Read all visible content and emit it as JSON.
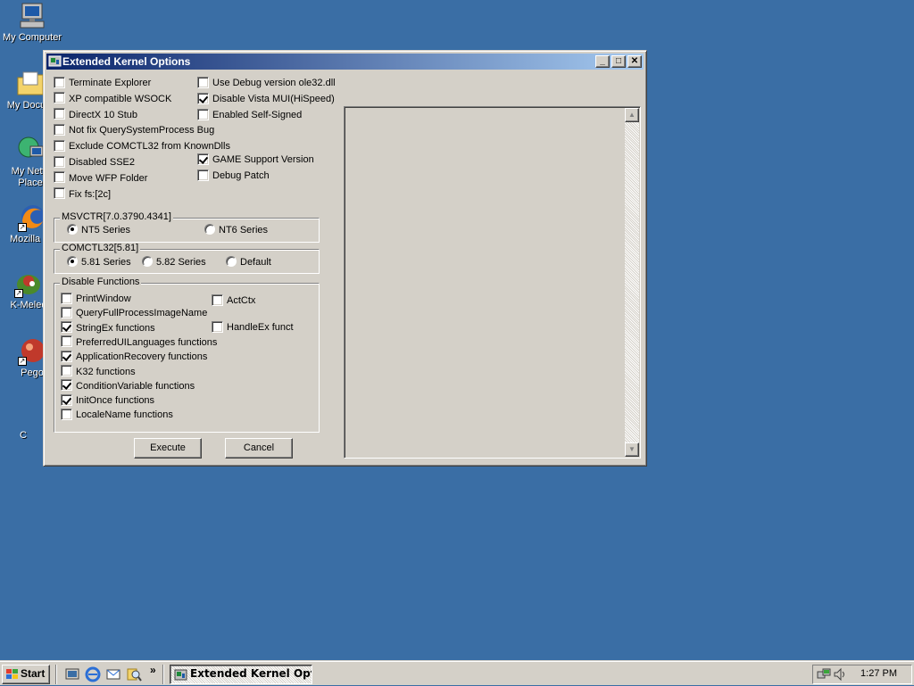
{
  "desktop": {
    "icons": [
      {
        "label": "My Computer",
        "icon": "my-computer-icon"
      },
      {
        "label": "My Docum",
        "icon": "folder-icon"
      },
      {
        "label": "My Netw",
        "label2": "Place",
        "icon": "network-icon"
      },
      {
        "label": "Mozilla Fir",
        "icon": "firefox-icon"
      },
      {
        "label": "K-Meleo",
        "icon": "kmeleon-icon"
      },
      {
        "label": "Pego",
        "icon": "pego-icon"
      },
      {
        "label": "C",
        "icon": "unknown-icon"
      }
    ]
  },
  "window": {
    "title": "Extended Kernel Options",
    "controls": {
      "minimize": "_",
      "maximize": "□",
      "close": "✕"
    },
    "options_left": [
      {
        "label": "Terminate Explorer",
        "checked": false
      },
      {
        "label": "XP compatible WSOCK",
        "checked": false
      },
      {
        "label": "DirectX 10 Stub",
        "checked": false
      },
      {
        "label": "Not fix QuerySystemProcess Bug",
        "checked": false
      },
      {
        "label": "Exclude COMCTL32 from KnownDlls",
        "checked": false
      },
      {
        "label": "Disabled SSE2",
        "checked": false
      },
      {
        "label": "Move WFP Folder",
        "checked": false
      },
      {
        "label": "Fix fs:[2c]",
        "checked": false
      }
    ],
    "options_right": [
      {
        "label": "Use Debug version ole32.dll",
        "checked": false
      },
      {
        "label": "Disable Vista MUI(HiSpeed)",
        "checked": true
      },
      {
        "label": "Enabled Self-Signed",
        "checked": false
      },
      {
        "label": "GAME Support Version",
        "checked": true
      },
      {
        "label": "Debug Patch",
        "checked": false
      }
    ],
    "msvctr": {
      "title": "MSVCTR[7.0.3790.4341]",
      "options": [
        {
          "label": "NT5 Series",
          "selected": true
        },
        {
          "label": "NT6 Series",
          "selected": false
        }
      ]
    },
    "comctl32": {
      "title": "COMCTL32[5.81]",
      "options": [
        {
          "label": "5.81 Series",
          "selected": true
        },
        {
          "label": "5.82 Series",
          "selected": false
        },
        {
          "label": "Default",
          "selected": false
        }
      ]
    },
    "disable_functions": {
      "title": "Disable Functions",
      "left": [
        {
          "label": "PrintWindow",
          "checked": false
        },
        {
          "label": "QueryFullProcessImageName",
          "checked": false
        },
        {
          "label": "StringEx functions",
          "checked": true
        },
        {
          "label": "PreferredUILanguages functions",
          "checked": false
        },
        {
          "label": "ApplicationRecovery functions",
          "checked": true
        },
        {
          "label": "K32 functions",
          "checked": false
        },
        {
          "label": "ConditionVariable functions",
          "checked": true
        },
        {
          "label": "InitOnce functions",
          "checked": true
        },
        {
          "label": "LocaleName functions",
          "checked": false
        }
      ],
      "right": [
        {
          "label": "ActCtx",
          "checked": false
        },
        {
          "label": "HandleEx funct",
          "checked": false
        }
      ]
    },
    "buttons": {
      "execute": "Execute",
      "cancel": "Cancel"
    }
  },
  "taskbar": {
    "start_label": "Start",
    "quick_launch_more": "»",
    "task_label": "Extended Kernel Optio...",
    "clock": "1:27 PM"
  },
  "colors": {
    "desktop": "#3a6ea5",
    "title_start": "#0a246a",
    "title_end": "#a6caf0",
    "face": "#d4d0c8"
  }
}
